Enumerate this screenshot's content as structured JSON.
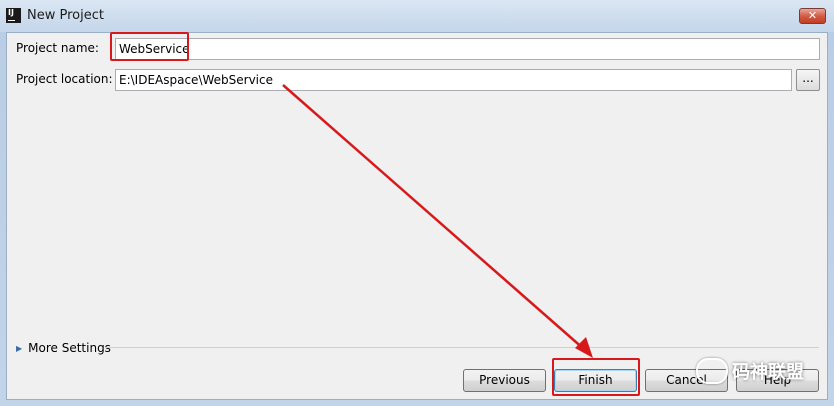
{
  "window": {
    "title": "New Project",
    "app_icon": "intellij-idea-icon",
    "close_symbol": "✕"
  },
  "form": {
    "project_name_label": "Project name:",
    "project_name_value": "WebService",
    "project_location_label": "Project location:",
    "project_location_value": "E:\\IDEAspace\\WebService",
    "browse_label": "...",
    "more_settings_label": "More Settings"
  },
  "buttons": {
    "previous": "Previous",
    "finish": "Finish",
    "cancel": "Cancel",
    "help": "Help"
  },
  "annotations": {
    "highlight_color": "#d8191b"
  },
  "watermark": {
    "text": "码神联盟",
    "icon": "wechat-icon"
  }
}
